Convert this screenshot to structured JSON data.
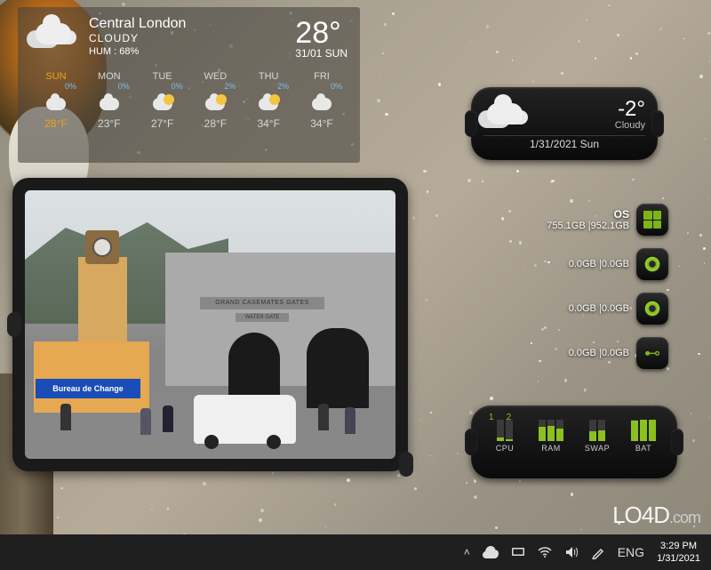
{
  "weather_large": {
    "city": "Central London",
    "condition": "CLOUDY",
    "humidity_label": "HUM : 68%",
    "temp": "28°",
    "date": "31/01 SUN",
    "forecast": [
      {
        "day": "SUN",
        "pop": "0%",
        "temp": "28°F",
        "highlight": true
      },
      {
        "day": "MON",
        "pop": "0%",
        "temp": "23°F",
        "highlight": false
      },
      {
        "day": "TUE",
        "pop": "0%",
        "temp": "27°F",
        "highlight": false
      },
      {
        "day": "WED",
        "pop": "2%",
        "temp": "28°F",
        "highlight": false
      },
      {
        "day": "THU",
        "pop": "2%",
        "temp": "34°F",
        "highlight": false
      },
      {
        "day": "FRI",
        "pop": "0%",
        "temp": "34°F",
        "highlight": false
      }
    ]
  },
  "weather_small": {
    "temp": "-2°",
    "condition": "Cloudy",
    "date": "1/31/2021 Sun"
  },
  "drives": {
    "os_label": "OS",
    "items": [
      {
        "used": "755.1GB",
        "total": "952.1GB",
        "icon": "windows"
      },
      {
        "used": "0.0GB",
        "total": "0.0GB",
        "icon": "disc"
      },
      {
        "used": "0.0GB",
        "total": "0.0GB",
        "icon": "disc"
      },
      {
        "used": "0.0GB",
        "total": "0.0GB",
        "icon": "usb"
      }
    ]
  },
  "sysmon": {
    "cores": [
      "1",
      "2"
    ],
    "meters": [
      {
        "label": "CPU",
        "fills": [
          15,
          8
        ]
      },
      {
        "label": "RAM",
        "fills": [
          65,
          70,
          60
        ]
      },
      {
        "label": "SWAP",
        "fills": [
          45,
          50
        ]
      },
      {
        "label": "BAT",
        "fills": [
          95,
          100,
          98
        ]
      }
    ]
  },
  "photo": {
    "bureau_sign": "Bureau de Change",
    "gates_sign": "GRAND CASEMATES GATES",
    "water_sign": "WATER GATE"
  },
  "taskbar": {
    "lang": "ENG",
    "time": "3:29 PM",
    "date": "1/31/2021"
  },
  "watermark": {
    "text": "LO4D",
    ".suffix": ".com"
  }
}
